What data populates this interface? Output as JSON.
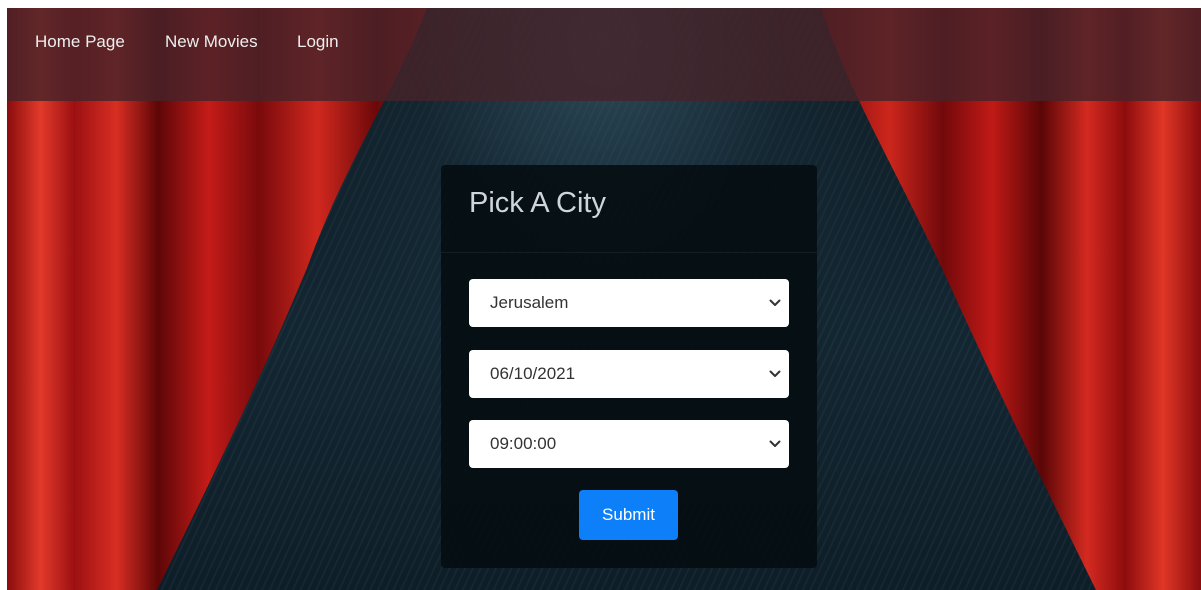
{
  "nav": {
    "links": [
      "Home Page",
      "New Movies",
      "Login"
    ]
  },
  "form": {
    "title": "Pick A City",
    "city": "Jerusalem",
    "date": "06/10/2021",
    "time": "09:00:00",
    "submit_label": "Submit"
  },
  "colors": {
    "accent": "#0d7ff8",
    "curtain": "#c0191b",
    "navbar": "#46232a"
  }
}
